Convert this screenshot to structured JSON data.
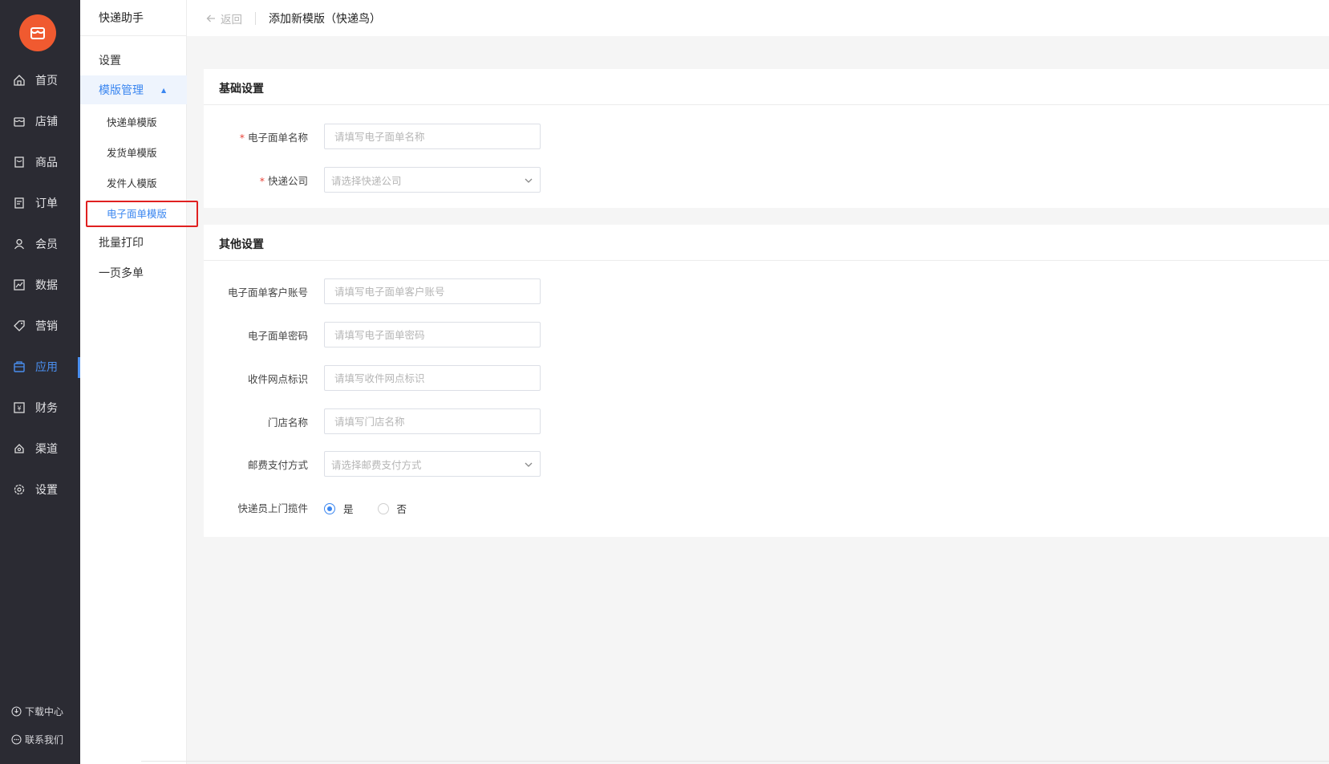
{
  "nav": {
    "items": [
      {
        "label": "首页",
        "icon": "home-icon"
      },
      {
        "label": "店铺",
        "icon": "store-icon"
      },
      {
        "label": "商品",
        "icon": "goods-icon"
      },
      {
        "label": "订单",
        "icon": "order-icon"
      },
      {
        "label": "会员",
        "icon": "member-icon"
      },
      {
        "label": "数据",
        "icon": "chart-icon"
      },
      {
        "label": "营销",
        "icon": "tag-icon"
      },
      {
        "label": "应用",
        "icon": "app-icon",
        "active": true
      },
      {
        "label": "财务",
        "icon": "finance-icon"
      },
      {
        "label": "渠道",
        "icon": "channel-icon"
      },
      {
        "label": "设置",
        "icon": "gear-icon"
      }
    ],
    "footer": {
      "download": "下载中心",
      "contact": "联系我们"
    },
    "accent_color": "#4a8ff0",
    "logo_color": "#f05a30"
  },
  "sub": {
    "title": "快递助手",
    "settings": "设置",
    "template_mgmt": "模版管理",
    "children": [
      "快递单模版",
      "发货单模版",
      "发件人模版",
      "电子面单模版"
    ],
    "batch_print": "批量打印",
    "multi_order": "一页多单"
  },
  "header": {
    "back": "返回",
    "title": "添加新模版（快递鸟）"
  },
  "basic": {
    "heading": "基础设置",
    "name_label": "电子面单名称",
    "name_placeholder": "请填写电子面单名称",
    "company_label": "快递公司",
    "company_placeholder": "请选择快递公司",
    "required_mark": "*"
  },
  "other": {
    "heading": "其他设置",
    "account_label": "电子面单客户账号",
    "account_placeholder": "请填写电子面单客户账号",
    "password_label": "电子面单密码",
    "password_placeholder": "请填写电子面单密码",
    "site_label": "收件网点标识",
    "site_placeholder": "请填写收件网点标识",
    "store_label": "门店名称",
    "store_placeholder": "请填写门店名称",
    "pay_label": "邮费支付方式",
    "pay_placeholder": "请选择邮费支付方式",
    "pickup_label": "快递员上门揽件",
    "pickup_yes": "是",
    "pickup_no": "否",
    "pickup_selected": "是"
  }
}
